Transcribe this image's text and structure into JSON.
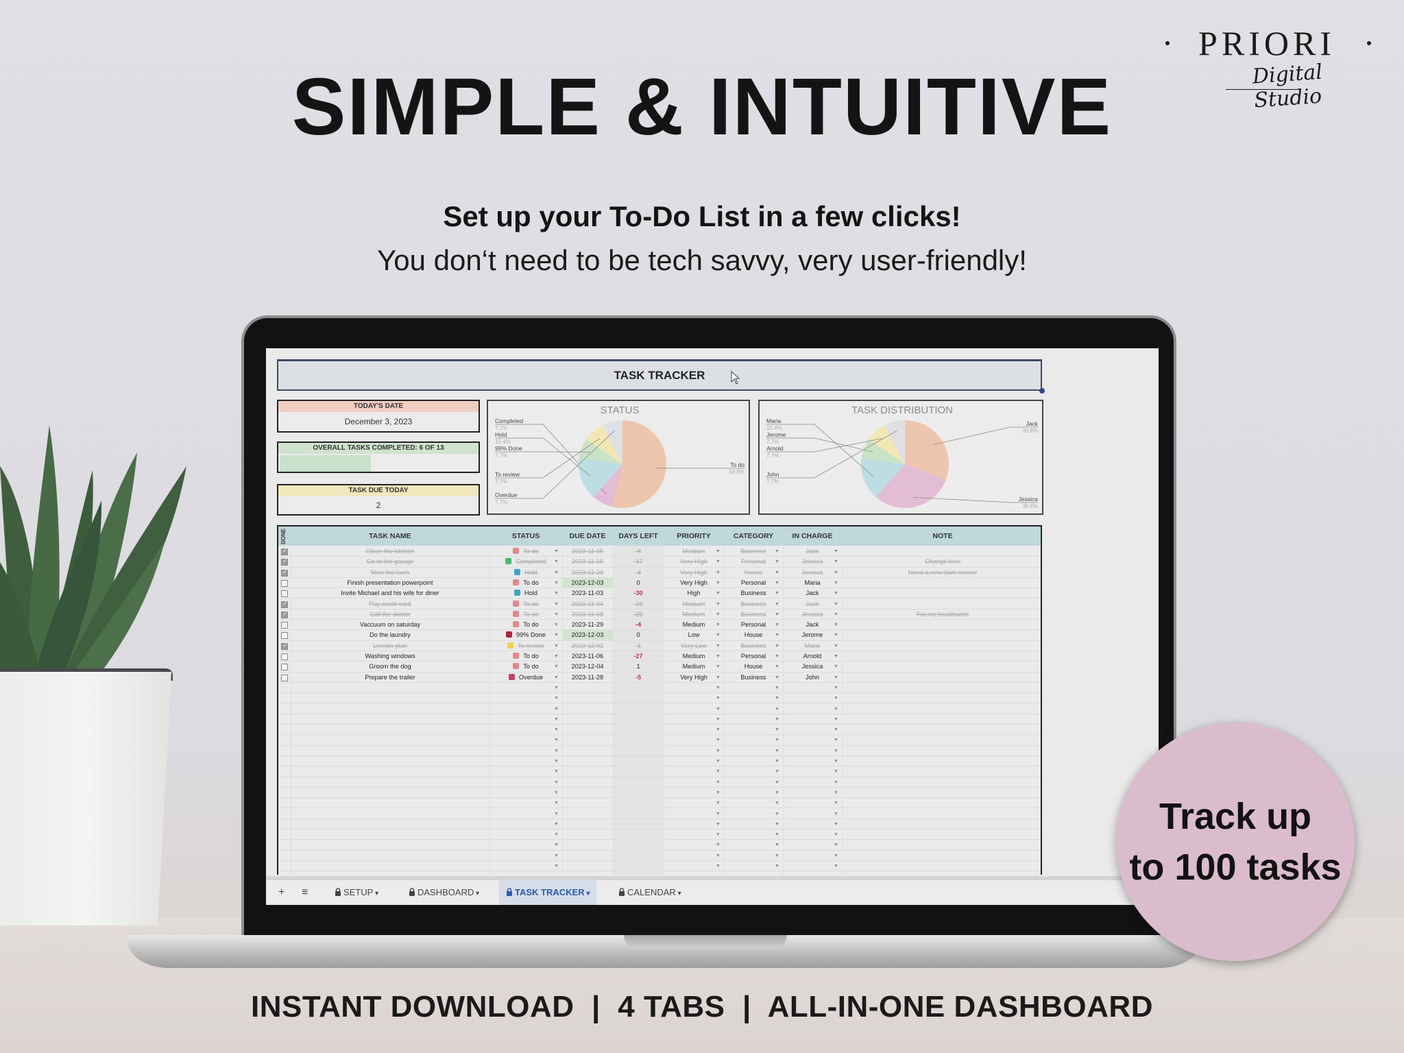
{
  "brand": {
    "name": "PRIORI",
    "tagline": "Digital Studio"
  },
  "hero": {
    "headline": "SIMPLE & INTUITIVE",
    "subhead": "Set up your To-Do List in a few clicks!",
    "subline": "You don‘t need to be tech savvy, very user-friendly!"
  },
  "badge": {
    "line1": "Track up",
    "line2": "to 100 tasks"
  },
  "footer": {
    "text": "INSTANT DOWNLOAD  |  4 TABS  |  ALL-IN-ONE DASHBOARD"
  },
  "sheet": {
    "title": "TASK TRACKER",
    "cards": {
      "date": {
        "label": "TODAY'S DATE",
        "value": "December 3, 2023"
      },
      "progress": {
        "label": "OVERALL TASKS COMPLETED: 6 OF 13",
        "completed": 6,
        "total": 13
      },
      "due": {
        "label": "TASK DUE TODAY",
        "value": "2"
      }
    },
    "colors": {
      "todo": "#eec5ad",
      "completed": "#e3bcd6",
      "hold": "#bcdde3",
      "done99": "#c9e3c6",
      "review": "#f2e7b3",
      "overdue": "#dfe0e5",
      "header": "#bfd8dc",
      "accent": "#2a5bb5",
      "negative": "#b2364a"
    },
    "columns": [
      "DONE",
      "TASK NAME",
      "STATUS",
      "DUE DATE",
      "DAYS LEFT",
      "PRIORITY",
      "CATEGORY",
      "IN CHARGE",
      "NOTE"
    ],
    "rows": [
      {
        "done": true,
        "task": "Clean the kitchen",
        "status": "To do",
        "due": "2023-11-25",
        "days": "-8",
        "priority": "Medium",
        "category": "Business",
        "owner": "Jack",
        "note": ""
      },
      {
        "done": true,
        "task": "Go to the garage",
        "status": "Completed",
        "due": "2023-11-16",
        "days": "-17",
        "priority": "Very High",
        "category": "Personal",
        "owner": "Jessica",
        "note": "Change tires"
      },
      {
        "done": true,
        "task": "Mow the lawn",
        "status": "Hold",
        "due": "2023-11-29",
        "days": "-4",
        "priority": "Very High",
        "category": "House",
        "owner": "Jessica",
        "note": "Need a new lawn mower"
      },
      {
        "done": false,
        "task": "Finish presentation powerpoint",
        "status": "To do",
        "due": "2023-12-03",
        "days": "0",
        "priority": "Very High",
        "category": "Personal",
        "owner": "Maria",
        "note": "",
        "dueToday": true
      },
      {
        "done": false,
        "task": "Invite Michael and his wife for diner",
        "status": "Hold",
        "due": "2023-11-03",
        "days": "-30",
        "priority": "High",
        "category": "Business",
        "owner": "Jack",
        "note": ""
      },
      {
        "done": true,
        "task": "Pay credit card",
        "status": "To do",
        "due": "2023-11-04",
        "days": "-29",
        "priority": "Medium",
        "category": "Business",
        "owner": "Jack",
        "note": ""
      },
      {
        "done": true,
        "task": "Call the doctor",
        "status": "To do",
        "due": "2023-11-08",
        "days": "-25",
        "priority": "Medium",
        "category": "Business",
        "owner": "Jessica",
        "note": "For my headhache"
      },
      {
        "done": false,
        "task": "Vaccuum on saturday",
        "status": "To do",
        "due": "2023-11-29",
        "days": "-4",
        "priority": "Medium",
        "category": "Personal",
        "owner": "Jack",
        "note": ""
      },
      {
        "done": false,
        "task": "Do the laundry",
        "status": "99% Done",
        "due": "2023-12-03",
        "days": "0",
        "priority": "Low",
        "category": "House",
        "owner": "Jerome",
        "note": "",
        "dueToday": true
      },
      {
        "done": true,
        "task": "Lesson plan",
        "status": "To review",
        "due": "2023-12-02",
        "days": "-1",
        "priority": "Very Low",
        "category": "Business",
        "owner": "Maria",
        "note": ""
      },
      {
        "done": false,
        "task": "Washing windows",
        "status": "To do",
        "due": "2023-11-06",
        "days": "-27",
        "priority": "Medium",
        "category": "Personal",
        "owner": "Arnold",
        "note": ""
      },
      {
        "done": false,
        "task": "Groom the dog",
        "status": "To do",
        "due": "2023-12-04",
        "days": "1",
        "priority": "Medium",
        "category": "House",
        "owner": "Jessica",
        "note": ""
      },
      {
        "done": false,
        "task": "Prepare the trailer",
        "status": "Overdue",
        "due": "2023-11-28",
        "days": "-5",
        "priority": "Very High",
        "category": "Business",
        "owner": "John",
        "note": ""
      }
    ],
    "empty_rows": 18,
    "tabs": [
      {
        "label": "SETUP",
        "active": false
      },
      {
        "label": "DASHBOARD",
        "active": false
      },
      {
        "label": "TASK TRACKER",
        "active": true
      },
      {
        "label": "CALENDAR",
        "active": false
      }
    ],
    "tab_controls": {
      "add": "+",
      "menu": "≡"
    }
  },
  "chart_data": [
    {
      "type": "pie",
      "title": "STATUS",
      "categories": [
        "To do",
        "Completed",
        "Hold",
        "99% Done",
        "To review",
        "Overdue"
      ],
      "values": [
        53.8,
        7.7,
        15.4,
        7.7,
        7.7,
        7.7
      ],
      "labels": [
        "53.8%",
        "7.7%",
        "15.4%",
        "7.7%",
        "7.7%",
        "7.7%"
      ],
      "colors": [
        "#eec5ad",
        "#e3bcd6",
        "#bcdde3",
        "#c9e3c6",
        "#f2e7b3",
        "#dfe0e5"
      ],
      "legend": "callouts-left-right"
    },
    {
      "type": "pie",
      "title": "TASK DISTRIBUTION",
      "categories": [
        "Jack",
        "Jessica",
        "Maria",
        "Jerome",
        "Arnold",
        "John"
      ],
      "values": [
        30.8,
        30.8,
        15.4,
        7.7,
        7.7,
        7.7
      ],
      "labels": [
        "30.8%",
        "30.8%",
        "15.4%",
        "7.7%",
        "7.7%",
        "7.7%"
      ],
      "colors": [
        "#eec5ad",
        "#e3bcd6",
        "#bcdde3",
        "#c9e3c6",
        "#f2e7b3",
        "#dfe0e5"
      ],
      "legend": "callouts-left-right"
    }
  ]
}
